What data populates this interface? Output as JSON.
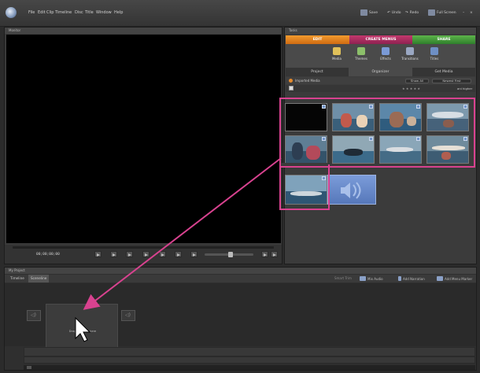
{
  "menu": [
    "File",
    "Edit",
    "Clip",
    "Timeline",
    "Disc",
    "Title",
    "Window",
    "Help"
  ],
  "toolbar": {
    "save": "Save",
    "undo": "Undo",
    "redo": "Redo",
    "fullscreen": "Full Screen"
  },
  "monitor": {
    "title": "Monitor",
    "timecode": "00;00;00;00"
  },
  "tasks": {
    "title": "Tasks",
    "main_tabs": [
      "EDIT",
      "CREATE MENUS",
      "SHARE"
    ],
    "tools": [
      "Media",
      "Themes",
      "Effects",
      "Transitions",
      "Titles"
    ],
    "subtabs": [
      "Project",
      "Organizer",
      "Get Media"
    ],
    "imported_label": "Imported Media",
    "show_all": "Show All",
    "newest_first": "Newest First",
    "keyword": "ani higher"
  },
  "project": {
    "title": "My Project",
    "tabs": [
      "Timeline",
      "Sceneline"
    ],
    "tools": [
      "Smart Trim",
      "Mix Audio",
      "Add Narration",
      "Add Menu Marker"
    ],
    "drop_text": "Drag next clip here"
  },
  "colors": {
    "edit_tab": "#e8821f",
    "create_menus_tab": "#b23263",
    "share_tab": "#47a03d",
    "highlight": "#d8428f",
    "audio_tile": "#6a8bcb"
  },
  "icons": {
    "media": "media-icon",
    "themes": "themes-icon",
    "effects": "effects-icon",
    "transitions": "transitions-icon",
    "titles": "titles-icon"
  }
}
